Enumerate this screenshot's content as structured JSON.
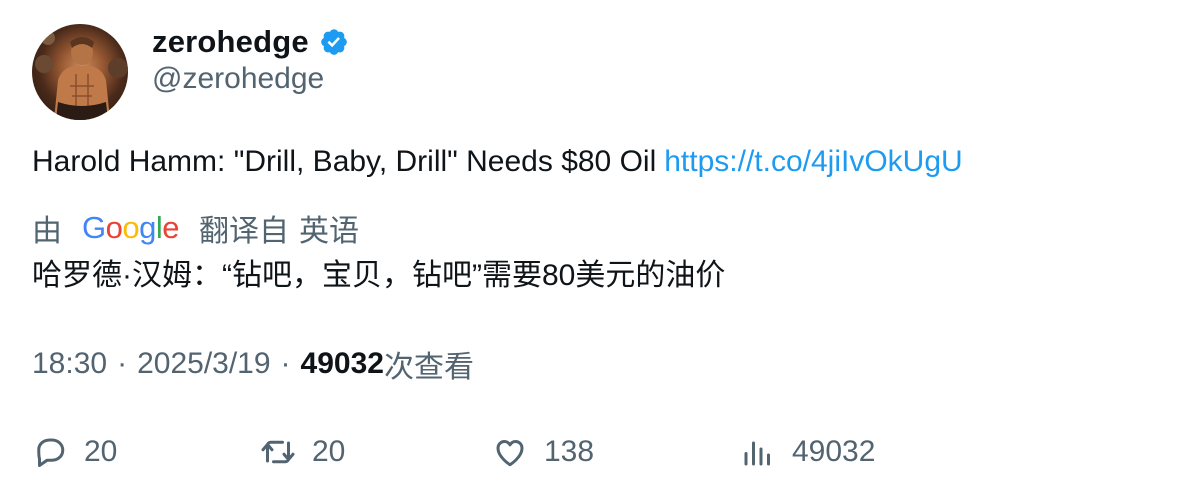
{
  "author": {
    "display_name": "zerohedge",
    "handle": "@zerohedge",
    "verified": true,
    "verified_color": "#1d9bf0"
  },
  "tweet": {
    "text": "Harold Hamm: \"Drill, Baby, Drill\" Needs $80 Oil",
    "link": "https://t.co/4jiIvOkUgU",
    "link_color": "#1d9bf0"
  },
  "translation": {
    "by_label": "由",
    "provider_letters": [
      "G",
      "o",
      "o",
      "g",
      "l",
      "e"
    ],
    "translated_from_label": "翻译自",
    "language": "英语",
    "text": "哈罗德·汉姆：“钻吧，宝贝，钻吧”需要80美元的油价"
  },
  "meta": {
    "time": "18:30",
    "separator": "·",
    "date": "2025/3/19",
    "views_count": "49032",
    "views_label": "次查看"
  },
  "actions": {
    "reply_count": "20",
    "retweet_count": "20",
    "like_count": "138",
    "views_count": "49032"
  },
  "icons": {
    "reply": "reply-icon",
    "retweet": "retweet-icon",
    "like": "heart-icon",
    "views": "analytics-icon",
    "verified": "verified-badge-icon"
  }
}
